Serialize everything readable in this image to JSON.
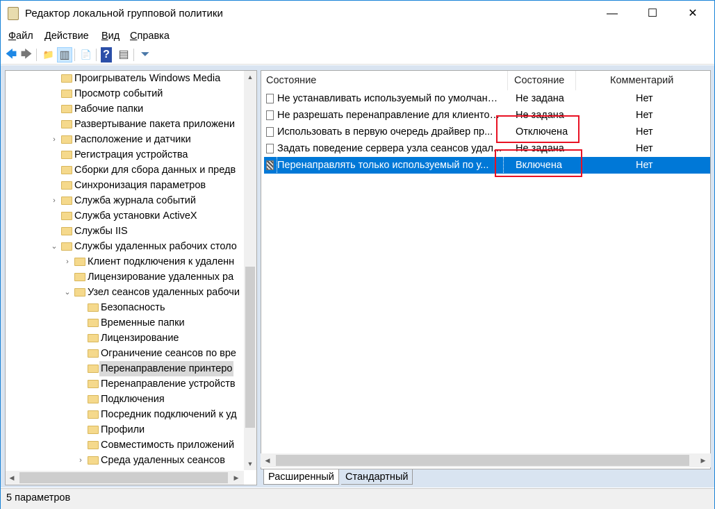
{
  "window": {
    "title": "Редактор локальной групповой политики",
    "minimize": "—",
    "maximize": "☐",
    "close": "✕"
  },
  "menu": [
    {
      "label": "Файл",
      "u": "Ф",
      "rest": "айл"
    },
    {
      "label": "Действие",
      "u": "Д",
      "rest": "ействие"
    },
    {
      "label": "Вид",
      "u": "В",
      "rest": "ид"
    },
    {
      "label": "Справка",
      "u": "С",
      "rest": "правка"
    }
  ],
  "toolbar": {
    "back": "🡄",
    "forward": "🡆",
    "up": "📁",
    "show_hide": "▥",
    "export": "📄",
    "help": "?",
    "properties": "▤",
    "filter": "⏷"
  },
  "tree": [
    {
      "label": "Проигрыватель Windows Media",
      "level": 0,
      "exp": ""
    },
    {
      "label": "Просмотр событий",
      "level": 0,
      "exp": ""
    },
    {
      "label": "Рабочие папки",
      "level": 0,
      "exp": ""
    },
    {
      "label": "Развертывание пакета приложени",
      "level": 0,
      "exp": ""
    },
    {
      "label": "Расположение и датчики",
      "level": 0,
      "exp": "›"
    },
    {
      "label": "Регистрация устройства",
      "level": 0,
      "exp": ""
    },
    {
      "label": "Сборки для сбора данных и предв",
      "level": 0,
      "exp": ""
    },
    {
      "label": "Синхронизация параметров",
      "level": 0,
      "exp": ""
    },
    {
      "label": "Служба журнала событий",
      "level": 0,
      "exp": "›"
    },
    {
      "label": "Служба установки ActiveX",
      "level": 0,
      "exp": ""
    },
    {
      "label": "Службы IIS",
      "level": 0,
      "exp": ""
    },
    {
      "label": "Службы удаленных рабочих столо",
      "level": 0,
      "exp": "⌄"
    },
    {
      "label": "Клиент подключения к удаленн",
      "level": 1,
      "exp": "›"
    },
    {
      "label": "Лицензирование удаленных ра",
      "level": 1,
      "exp": ""
    },
    {
      "label": "Узел сеансов удаленных рабочи",
      "level": 1,
      "exp": "⌄"
    },
    {
      "label": "Безопасность",
      "level": 2,
      "exp": ""
    },
    {
      "label": "Временные папки",
      "level": 2,
      "exp": ""
    },
    {
      "label": "Лицензирование",
      "level": 2,
      "exp": ""
    },
    {
      "label": "Ограничение сеансов по вре",
      "level": 2,
      "exp": ""
    },
    {
      "label": "Перенаправление принтеро",
      "level": 2,
      "exp": "",
      "selected": true
    },
    {
      "label": "Перенаправление устройств",
      "level": 2,
      "exp": ""
    },
    {
      "label": "Подключения",
      "level": 2,
      "exp": ""
    },
    {
      "label": "Посредник подключений к уд",
      "level": 2,
      "exp": ""
    },
    {
      "label": "Профили",
      "level": 2,
      "exp": ""
    },
    {
      "label": "Совместимость приложений",
      "level": 2,
      "exp": ""
    },
    {
      "label": "Среда удаленных сеансов",
      "level": 2,
      "exp": "›"
    }
  ],
  "list": {
    "headers": {
      "name": "Состояние",
      "state": "Состояние",
      "comment": "Комментарий"
    },
    "rows": [
      {
        "name": "Не устанавливать используемый по умолчанию...",
        "state": "Не задана",
        "comment": "Нет"
      },
      {
        "name": "Не разрешать перенаправление для клиентов...",
        "state": "Не задана",
        "comment": "Нет"
      },
      {
        "name": "Использовать в первую очередь драйвер пр...",
        "state": "Отключена",
        "comment": "Нет"
      },
      {
        "name": "Задать поведение сервера узла сеансов удал...",
        "state": "Не задана",
        "comment": "Нет"
      },
      {
        "name": "Перенаправлять только используемый по у...",
        "state": "Включена",
        "comment": "Нет",
        "selected": true
      }
    ]
  },
  "tabs": {
    "extended": "Расширенный",
    "standard": "Стандартный"
  },
  "status": "5 параметров",
  "colors": {
    "selection": "#0078d7",
    "highlight_box": "#e81123"
  }
}
